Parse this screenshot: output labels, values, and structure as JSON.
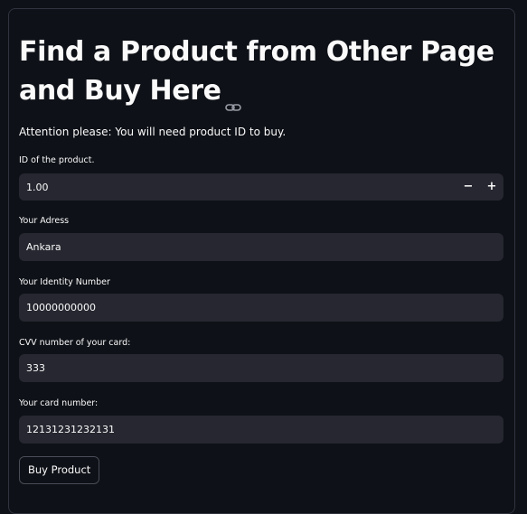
{
  "page": {
    "title": "Find a Product from Other Page and Buy Here",
    "attention": "Attention please: You will need product ID to buy."
  },
  "form": {
    "product_id": {
      "label": "ID of the product.",
      "value": "1.00",
      "decrement_label": "−",
      "increment_label": "+"
    },
    "address": {
      "label": "Your Adress",
      "value": "Ankara"
    },
    "identity": {
      "label": "Your Identity Number",
      "value": "10000000000"
    },
    "cvv": {
      "label": "CVV number of your card:",
      "value": "333"
    },
    "card_number": {
      "label": "Your card number:",
      "value": "12131231232131"
    },
    "submit_label": "Buy Product"
  },
  "icons": {
    "title_anchor": "link-icon"
  },
  "colors": {
    "background": "#0e1117",
    "input_bg": "#262730",
    "text": "#fafafa",
    "border": "#31333f"
  }
}
